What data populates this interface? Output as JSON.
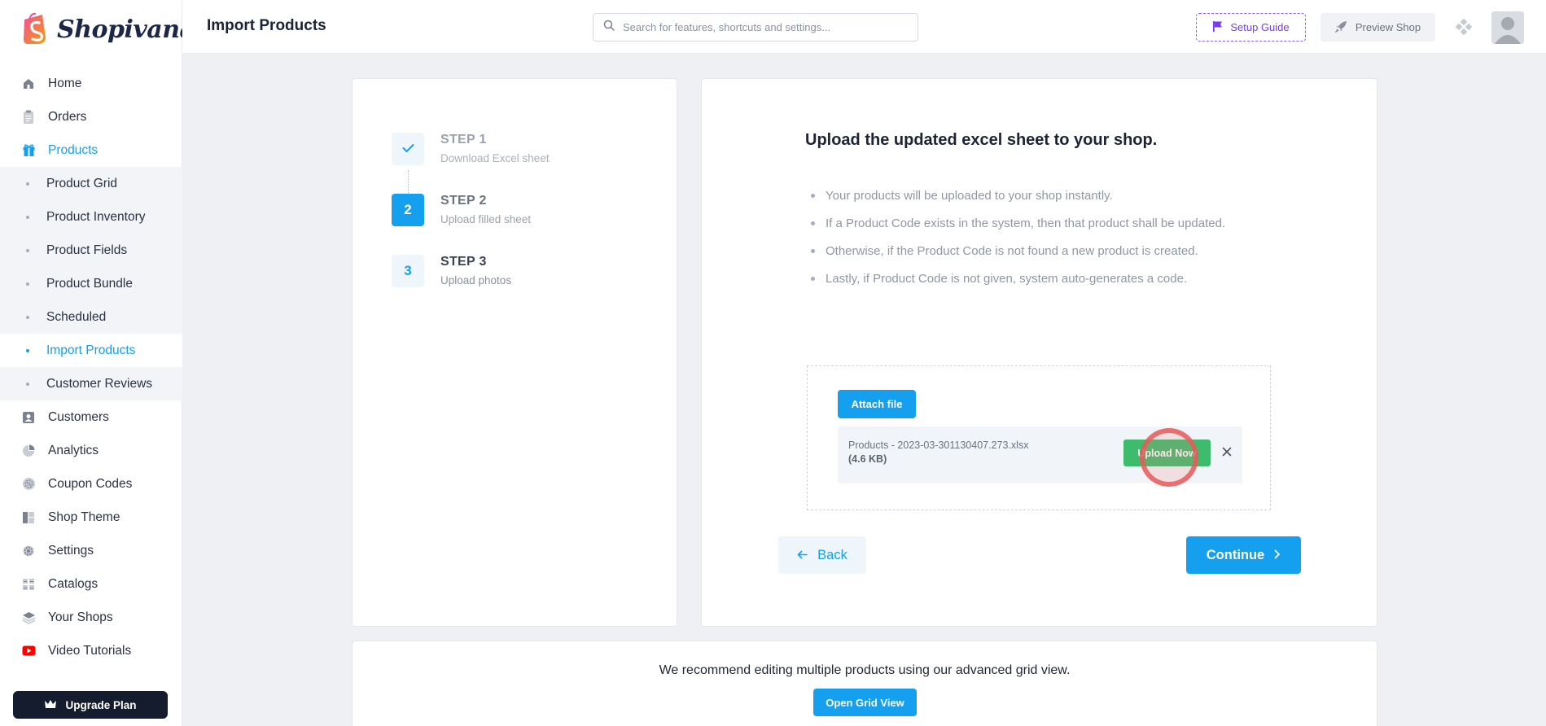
{
  "brand": {
    "name": "Shopivana",
    "accent": "#14a0ef"
  },
  "header": {
    "title": "Import Products",
    "search_placeholder": "Search for features, shortcuts and settings...",
    "setup_guide": "Setup Guide",
    "preview_shop": "Preview Shop"
  },
  "sidebar": {
    "items": [
      {
        "label": "Home",
        "icon": "home-icon"
      },
      {
        "label": "Orders",
        "icon": "clipboard-icon"
      },
      {
        "label": "Products",
        "icon": "gift-icon",
        "active": true
      }
    ],
    "sub_items": [
      {
        "label": "Product Grid"
      },
      {
        "label": "Product Inventory"
      },
      {
        "label": "Product Fields"
      },
      {
        "label": "Product Bundle"
      },
      {
        "label": "Scheduled"
      },
      {
        "label": "Import Products",
        "active": true
      },
      {
        "label": "Customer Reviews"
      }
    ],
    "items_after": [
      {
        "label": "Customers",
        "icon": "user-card-icon"
      },
      {
        "label": "Analytics",
        "icon": "pie-chart-icon"
      },
      {
        "label": "Coupon Codes",
        "icon": "coupon-icon"
      },
      {
        "label": "Shop Theme",
        "icon": "layout-icon"
      },
      {
        "label": "Settings",
        "icon": "gear-icon"
      },
      {
        "label": "Catalogs",
        "icon": "catalog-icon"
      },
      {
        "label": "Your Shops",
        "icon": "layers-icon"
      },
      {
        "label": "Video Tutorials",
        "icon": "youtube-icon"
      }
    ],
    "upgrade_label": "Upgrade Plan"
  },
  "steps": [
    {
      "badge": "",
      "title": "STEP 1",
      "subtitle": "Download Excel sheet",
      "status": "done"
    },
    {
      "badge": "2",
      "title": "STEP 2",
      "subtitle": "Upload filled sheet",
      "status": "current"
    },
    {
      "badge": "3",
      "title": "STEP 3",
      "subtitle": "Upload photos",
      "status": "todo"
    }
  ],
  "upload": {
    "title": "Upload the updated excel sheet to your shop.",
    "bullets": [
      "Your products will be uploaded to your shop instantly.",
      "If a Product Code exists in the system, then that product shall be updated.",
      "Otherwise, if the Product Code is not found a new product is created.",
      "Lastly, if Product Code is not given, system auto-generates a code."
    ],
    "attach_label": "Attach file",
    "file_name": "Products - 2023-03-301130407.273.xlsx",
    "file_size": "(4.6 KB)",
    "upload_now_label": "Upload Now",
    "back_label": "Back",
    "continue_label": "Continue"
  },
  "recommend": {
    "text": "We recommend editing multiple products using our advanced grid view.",
    "button_label": "Open Grid View"
  }
}
